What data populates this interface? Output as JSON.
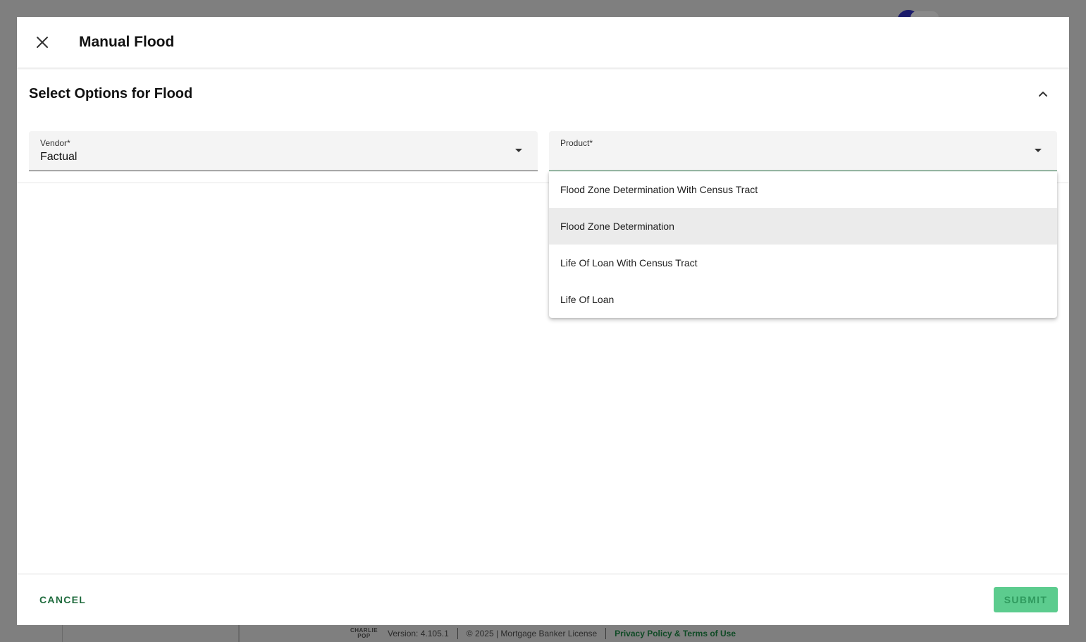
{
  "modal": {
    "title": "Manual Flood",
    "section_title": "Select Options for Flood",
    "vendor": {
      "label": "Vendor*",
      "value": "Factual"
    },
    "product": {
      "label": "Product*",
      "value": "",
      "options": [
        "Flood Zone Determination With Census Tract",
        "Flood Zone Determination",
        "Life Of Loan With Census Tract",
        "Life Of Loan"
      ],
      "highlighted_index": 1
    },
    "cancel_label": "CANCEL",
    "submit_label": "SUBMIT"
  },
  "footer": {
    "logo_text_top": "CHARLIE",
    "logo_text_bottom": "POP",
    "version": "Version: 4.105.1",
    "copyright": "© 2025 | Mortgage Banker License",
    "privacy_link": "Privacy Policy & Terms of Use"
  },
  "colors": {
    "accent": "#1f6b3d",
    "submit_bg": "#5ccc8e",
    "overlay": "#7f7f7f"
  },
  "icons": {
    "close": "close-icon",
    "collapse": "chevron-up-icon",
    "dropdown": "caret-down-icon"
  }
}
